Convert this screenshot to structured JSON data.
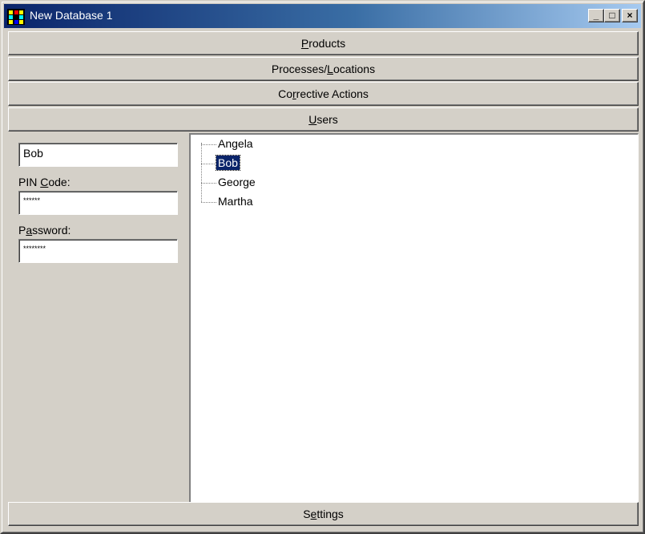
{
  "window": {
    "title": "New Database 1"
  },
  "titlebar_buttons": {
    "minimize": "_",
    "maximize": "□",
    "close": "×"
  },
  "sections": {
    "products": {
      "pre": "",
      "key": "P",
      "post": "roducts"
    },
    "processes": {
      "pre": "Processes/",
      "key": "L",
      "post": "ocations"
    },
    "corrective": {
      "pre": "Co",
      "key": "r",
      "post": "rective Actions"
    },
    "users": {
      "pre": "",
      "key": "U",
      "post": "sers"
    },
    "settings": {
      "pre": "S",
      "key": "e",
      "post": "ttings"
    }
  },
  "user_form": {
    "name_value": "Bob",
    "pin_label": {
      "pre": "PIN ",
      "key": "C",
      "post": "ode:"
    },
    "pin_value": "******",
    "password_label": {
      "pre": "P",
      "key": "a",
      "post": "ssword:"
    },
    "password_value": "********"
  },
  "users_tree": {
    "items": [
      "Angela",
      "Bob",
      "George",
      "Martha"
    ],
    "selected": "Bob"
  },
  "colors": {
    "face": "#d4d0c8",
    "title_start": "#0a246a",
    "title_end": "#a6caf0",
    "selection": "#0a246a"
  },
  "icons": {
    "app": "app-grid-icon",
    "minimize": "minimize-icon",
    "maximize": "maximize-icon",
    "close": "close-icon"
  }
}
